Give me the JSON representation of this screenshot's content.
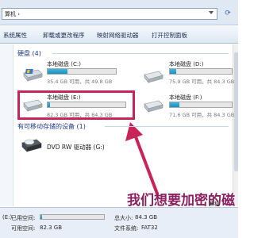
{
  "address": {
    "text": "算机 ›"
  },
  "toolbar": {
    "system_properties": "系统属性",
    "uninstall": "卸载或更改程序",
    "map_drive": "映射网络驱动器",
    "control_panel": "打开控制面板"
  },
  "hard_disks": {
    "header": "硬盘 (4)",
    "drives": [
      {
        "name": "本地磁盘 (C:)",
        "info": "35.4 GB 可用，共 49.8 GB",
        "fill": 0.29
      },
      {
        "name": "本地磁盘 (D:)",
        "info": "75.9 GB 可用，共 84.3 GB",
        "fill": 0.1
      },
      {
        "name": "本地磁盘 (E:)",
        "info": "82.3 GB 可用，共 84.3 GB",
        "fill": 0.03
      },
      {
        "name": "本地磁盘 (F:)",
        "info": "71.6 GB 可用，共 84.3 GB",
        "fill": 0.15
      }
    ]
  },
  "removable": {
    "header": "有可移动存储的设备 (1)",
    "dvd_name": "DVD RW 驱动器 (G:)"
  },
  "caption": "我们想要加密的磁",
  "watermark": "教程",
  "status": {
    "drive": "(E:)",
    "used_label": "已用空间:",
    "free_label": "可用空间:",
    "free_value": "82.3 GB",
    "total_label": "总大小:",
    "total_value": "84.3 GB",
    "fs_label": "文件系统:",
    "fs_value": "FAT32",
    "used_fill": 0.03
  },
  "colors": {
    "highlight": "#c8245a",
    "bar_fill": "#1a8ec0",
    "caption": "#8a2060"
  }
}
